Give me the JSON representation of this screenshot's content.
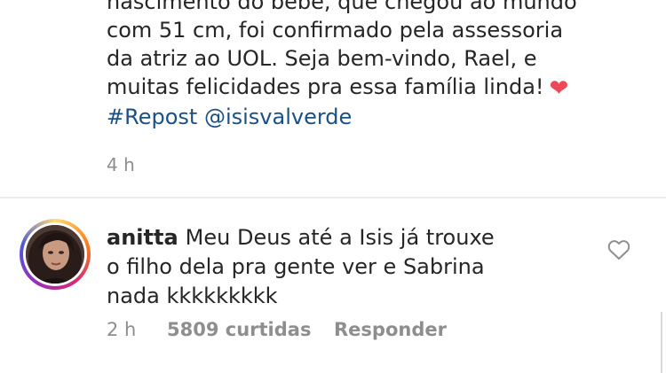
{
  "post": {
    "caption_lines": [
      "nascimento do bebê, que chegou ao mundo",
      "com 51 cm, foi confirmado pela assessoria",
      "da atriz ao UOL. Seja bem-vindo, Rael, e",
      "muitas felicidades pra essa família linda!"
    ],
    "heart_glyph": "❤",
    "hashtag": "#Repost",
    "mention": "@isisvalverde",
    "time": "4 h"
  },
  "comment": {
    "username": "anitta",
    "text_lines": [
      "Meu Deus até a Isis já trouxe",
      "o filho dela pra gente ver e Sabrina",
      "nada kkkkkkkkk"
    ],
    "time": "2 h",
    "likes": "5809 curtidas",
    "reply_label": "Responder",
    "like_icon": "heart-outline-icon"
  },
  "colors": {
    "text": "#262626",
    "muted": "#8e8e8e",
    "link": "#1a5088",
    "heart": "#ed4956"
  }
}
